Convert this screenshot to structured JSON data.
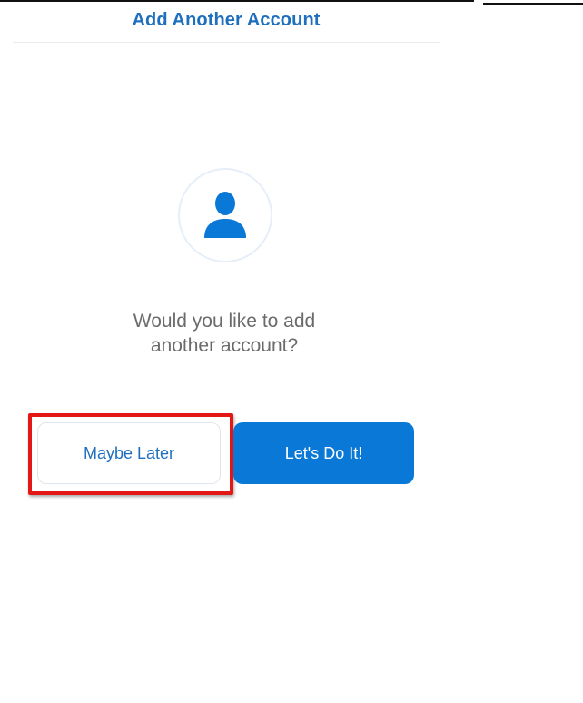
{
  "header": {
    "title": "Add Another Account"
  },
  "avatar": {
    "icon": "person-icon",
    "color": "#0a78d7"
  },
  "prompt": {
    "text": "Would you like to add\nanother account?"
  },
  "buttons": {
    "maybe_later_label": "Maybe Later",
    "lets_do_it_label": "Let's Do It!"
  },
  "colors": {
    "accent": "#0a78d7",
    "title": "#1f6fbf",
    "highlight": "#e41717"
  }
}
